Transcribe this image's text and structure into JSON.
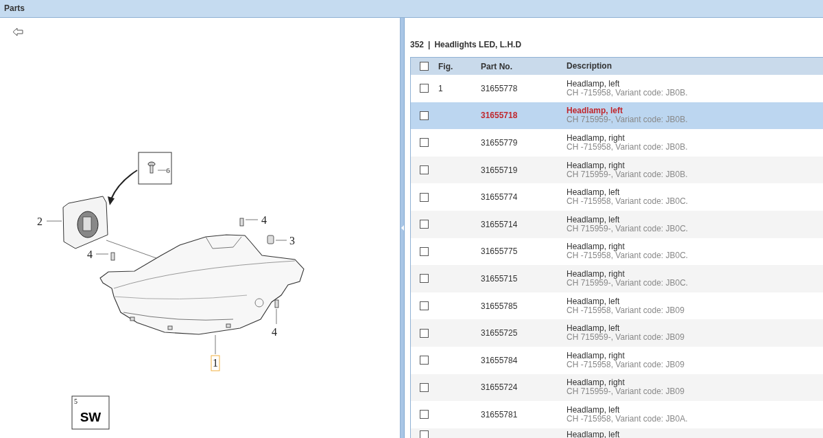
{
  "header": {
    "title": "Parts"
  },
  "diagram": {
    "callouts": [
      {
        "label": "6",
        "selected": false
      },
      {
        "label": "2",
        "selected": false
      },
      {
        "label": "4",
        "selected": false
      },
      {
        "label": "3",
        "selected": false
      },
      {
        "label": "4",
        "selected": false
      },
      {
        "label": "4",
        "selected": false
      },
      {
        "label": "1",
        "selected": true
      }
    ],
    "symbol": {
      "index": "5",
      "code": "SW"
    }
  },
  "parts": {
    "group_number": "352",
    "separator": "|",
    "group_title": "Headlights LED, L.H.D",
    "columns": [
      "Fig.",
      "Part No.",
      "Description"
    ],
    "all_checked": false,
    "rows": [
      {
        "fig": "1",
        "part_no": "31655778",
        "title": "Headlamp, left",
        "note": "CH -715958, Variant code: JB0B.",
        "checked": false,
        "selected": false
      },
      {
        "part_no": "31655718",
        "title": "Headlamp, left",
        "note": "CH 715959-, Variant code: JB0B.",
        "checked": false,
        "selected": true
      },
      {
        "part_no": "31655779",
        "title": "Headlamp, right",
        "note": "CH -715958, Variant code: JB0B.",
        "checked": false,
        "selected": false
      },
      {
        "part_no": "31655719",
        "title": "Headlamp, right",
        "note": "CH 715959-, Variant code: JB0B.",
        "checked": false,
        "selected": false
      },
      {
        "part_no": "31655774",
        "title": "Headlamp, left",
        "note": "CH -715958, Variant code: JB0C.",
        "checked": false,
        "selected": false
      },
      {
        "part_no": "31655714",
        "title": "Headlamp, left",
        "note": "CH 715959-, Variant code: JB0C.",
        "checked": false,
        "selected": false
      },
      {
        "part_no": "31655775",
        "title": "Headlamp, right",
        "note": "CH -715958, Variant code: JB0C.",
        "checked": false,
        "selected": false
      },
      {
        "part_no": "31655715",
        "title": "Headlamp, right",
        "note": "CH 715959-, Variant code: JB0C.",
        "checked": false,
        "selected": false
      },
      {
        "part_no": "31655785",
        "title": "Headlamp, left",
        "note": "CH -715958, Variant code: JB09",
        "checked": false,
        "selected": false
      },
      {
        "part_no": "31655725",
        "title": "Headlamp, left",
        "note": "CH 715959-, Variant code: JB09",
        "checked": false,
        "selected": false
      },
      {
        "part_no": "31655784",
        "title": "Headlamp, right",
        "note": "CH -715958, Variant code: JB09",
        "checked": false,
        "selected": false
      },
      {
        "part_no": "31655724",
        "title": "Headlamp, right",
        "note": "CH 715959-, Variant code: JB09",
        "checked": false,
        "selected": false
      },
      {
        "part_no": "31655781",
        "title": "Headlamp, left",
        "note": "CH -715958, Variant code: JB0A.",
        "checked": false,
        "selected": false
      },
      {
        "title": "Headlamp, left",
        "checked": false,
        "selected": false
      }
    ]
  }
}
